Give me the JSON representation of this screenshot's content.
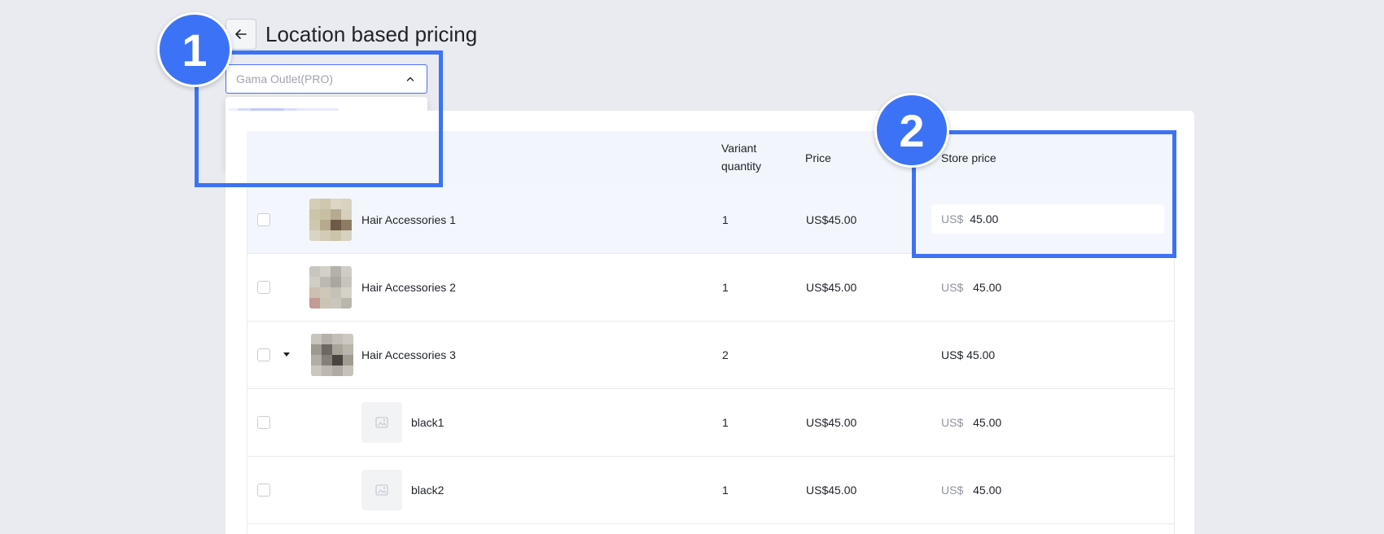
{
  "header": {
    "title": "Location based pricing"
  },
  "location_select": {
    "value": "Gama Outlet(PRO)"
  },
  "table": {
    "columns": {
      "variant_quantity": "Variant\nquantity",
      "price": "Price",
      "store_price": "Store price"
    },
    "rows": [
      {
        "name": "Hair Accessories 1",
        "quantity": "1",
        "price": "US$45.00",
        "store_currency": "US$",
        "store_value": "45.00"
      },
      {
        "name": "Hair Accessories 2",
        "quantity": "1",
        "price": "US$45.00",
        "store_currency": "US$",
        "store_value": "45.00"
      },
      {
        "name": "Hair Accessories 3",
        "quantity": "2",
        "price": "",
        "store_currency": "US$",
        "store_value": "45.00"
      },
      {
        "name": "black1",
        "quantity": "1",
        "price": "US$45.00",
        "store_currency": "US$",
        "store_value": "45.00"
      },
      {
        "name": "black2",
        "quantity": "1",
        "price": "US$45.00",
        "store_currency": "US$",
        "store_value": "45.00"
      }
    ]
  },
  "annotations": {
    "step1": "1",
    "step2": "2"
  },
  "colors": {
    "accent": "#3c72f5",
    "select_border": "#4f6ef7",
    "header_bg": "#f2f5fb",
    "highlight_row": "#f3f6fd"
  }
}
